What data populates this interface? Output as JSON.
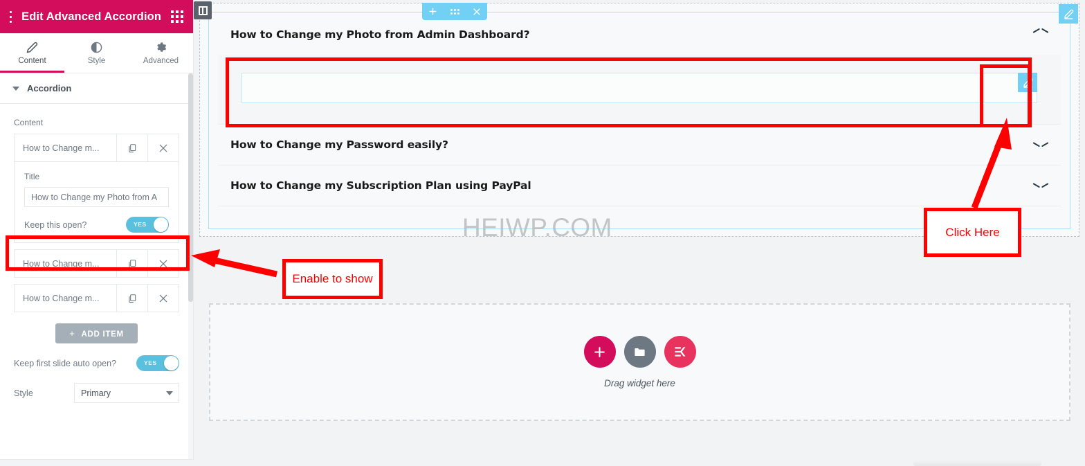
{
  "panel": {
    "header": {
      "title": "Edit Advanced Accordion",
      "menu_icon": "hamburger-icon",
      "apps_icon": "grid-apps-icon"
    },
    "tabs": [
      {
        "label": "Content",
        "icon": "pencil-icon",
        "active": true
      },
      {
        "label": "Style",
        "icon": "contrast-icon",
        "active": false
      },
      {
        "label": "Advanced",
        "icon": "gear-icon",
        "active": false
      }
    ],
    "section": {
      "label": "Accordion",
      "caret": "caret-down-icon"
    },
    "content_label": "Content",
    "items": [
      {
        "title": "How to Change m...",
        "duplicate_icon": "copy-icon",
        "remove_icon": "close-icon",
        "expanded": true
      },
      {
        "title": "How to Change m...",
        "duplicate_icon": "copy-icon",
        "remove_icon": "close-icon",
        "expanded": false
      },
      {
        "title": "How to Change m...",
        "duplicate_icon": "copy-icon",
        "remove_icon": "close-icon",
        "expanded": false
      }
    ],
    "item_editor": {
      "title_label": "Title",
      "title_value": "How to Change my Photo from A",
      "keep_open_label": "Keep this open?",
      "keep_open_value": "YES"
    },
    "add_item_label": "ADD ITEM",
    "add_item_plus": "+",
    "keep_first_label": "Keep first slide auto open?",
    "keep_first_value": "YES",
    "style_label": "Style",
    "style_value": "Primary",
    "style_options": [
      "Primary"
    ]
  },
  "canvas": {
    "panel_toggle_icon": "panel-collapse-icon",
    "section_toolbar": {
      "add_icon": "plus-icon",
      "drag_icon": "drag-dots-icon",
      "close_icon": "close-icon"
    },
    "section_edit_icon": "pencil-edit-icon",
    "content_edit_icon": "pencil-edit-icon",
    "accordion": [
      {
        "title": "How to Change my Photo from Admin Dashboard?",
        "state": "open",
        "chevron": "chevron-up-icon"
      },
      {
        "title": "How to Change my Password easily?",
        "state": "closed",
        "chevron": "chevron-down-icon"
      },
      {
        "title": "How to Change my Subscription Plan using PayPal",
        "state": "closed",
        "chevron": "chevron-down-icon"
      }
    ],
    "watermark": "HEIWP.COM",
    "dropzone": {
      "text": "Drag widget here",
      "buttons": [
        {
          "icon": "plus-icon",
          "name": "add-new-section"
        },
        {
          "icon": "folder-icon",
          "name": "add-template"
        },
        {
          "icon": "elementor-kit-icon",
          "name": "add-kit"
        }
      ]
    }
  },
  "annotations": {
    "click_here": "Click Here",
    "enable_to_show": "Enable to show",
    "color": "#fd0000"
  },
  "colors": {
    "brand_pink": "#d30c5c",
    "accent_blue": "#72d0f4",
    "toggle_blue": "#5bc0de",
    "panel_grey": "#6d7882",
    "annotation_red": "#fd0000"
  }
}
